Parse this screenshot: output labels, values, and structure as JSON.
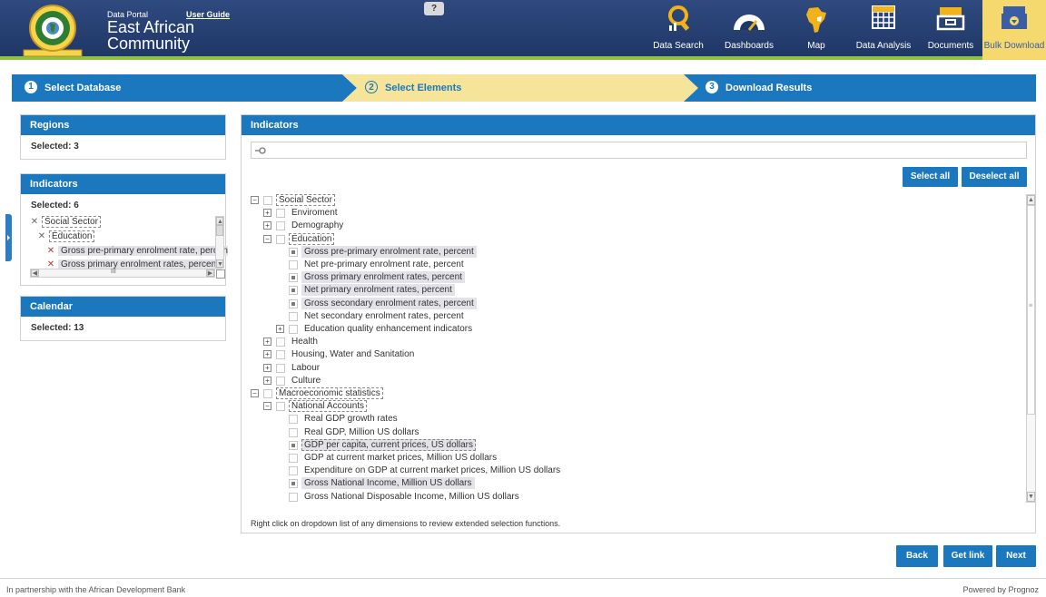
{
  "header": {
    "portal_label": "Data Portal",
    "user_guide": "User Guide",
    "title": "East African Community",
    "help": "?",
    "nav": [
      {
        "label": "Data Search",
        "icon": "search-chart-icon"
      },
      {
        "label": "Dashboards",
        "icon": "gauge-icon"
      },
      {
        "label": "Map",
        "icon": "africa-map-icon"
      },
      {
        "label": "Data Analysis",
        "icon": "grid-table-icon"
      },
      {
        "label": "Documents",
        "icon": "document-tray-icon"
      },
      {
        "label": "Bulk Download",
        "icon": "download-box-icon",
        "active": true
      }
    ]
  },
  "wizard": {
    "steps": [
      {
        "num": "1",
        "label": "Select Database"
      },
      {
        "num": "2",
        "label": "Select Elements"
      },
      {
        "num": "3",
        "label": "Download Results"
      }
    ]
  },
  "left": {
    "regions": {
      "title": "Regions",
      "selected": "Selected: 3"
    },
    "indicators": {
      "title": "Indicators",
      "selected": "Selected: 6",
      "tree": [
        "Social Sector",
        "Education",
        "Gross pre-primary enrolment rate, percen",
        "Gross primary enrolment rates, percent"
      ],
      "hscroll_thumb": "III"
    },
    "calendar": {
      "title": "Calendar",
      "selected": "Selected: 13"
    }
  },
  "main": {
    "title": "Indicators",
    "search": {
      "value": "",
      "placeholder": ""
    },
    "select_all": "Select all",
    "deselect_all": "Deselect all",
    "tree": [
      {
        "label": "Social Sector",
        "level": 0,
        "exp": "−",
        "checked": false,
        "style": "dash"
      },
      {
        "label": "Enviroment",
        "level": 1,
        "exp": "+",
        "checked": false
      },
      {
        "label": "Demography",
        "level": 1,
        "exp": "+",
        "checked": false
      },
      {
        "label": "Education",
        "level": 1,
        "exp": "−",
        "checked": false,
        "style": "dash"
      },
      {
        "label": "Gross pre-primary enrolment rate, percent",
        "level": 2,
        "checked": true,
        "style": "sel"
      },
      {
        "label": "Net pre-primary enrolment rate, percent",
        "level": 2,
        "checked": false
      },
      {
        "label": "Gross primary enrolment rates, percent",
        "level": 2,
        "checked": true,
        "style": "sel"
      },
      {
        "label": "Net primary enrolment rates, percent",
        "level": 2,
        "checked": true,
        "style": "sel"
      },
      {
        "label": "Gross secondary enrolment rates, percent",
        "level": 2,
        "checked": true,
        "style": "sel"
      },
      {
        "label": "Net secondary enrolment rates, percent",
        "level": 2,
        "checked": false
      },
      {
        "label": "Education quality enhancement indicators",
        "level": 2,
        "exp": "+",
        "checked": false
      },
      {
        "label": "Health",
        "level": 1,
        "exp": "+",
        "checked": false
      },
      {
        "label": "Housing, Water and Sanitation",
        "level": 1,
        "exp": "+",
        "checked": false
      },
      {
        "label": "Labour",
        "level": 1,
        "exp": "+",
        "checked": false
      },
      {
        "label": "Culture",
        "level": 1,
        "exp": "+",
        "checked": false
      },
      {
        "label": "Macroeconomic statistics",
        "level": 0,
        "exp": "−",
        "checked": false,
        "style": "dash"
      },
      {
        "label": "National Accounts",
        "level": 1,
        "exp": "−",
        "checked": false,
        "style": "dash"
      },
      {
        "label": "Real GDP growth rates",
        "level": 2,
        "checked": false
      },
      {
        "label": "Real GDP, Million US dollars",
        "level": 2,
        "checked": false
      },
      {
        "label": "GDP per capita, current prices, US dollars",
        "level": 2,
        "checked": true,
        "style": "seldash"
      },
      {
        "label": "GDP at current market prices, Million US dollars",
        "level": 2,
        "checked": false
      },
      {
        "label": "Expenditure on GDP at current market prices, Million US dollars",
        "level": 2,
        "checked": false
      },
      {
        "label": "Gross National Income, Million US dollars",
        "level": 2,
        "checked": true,
        "style": "sel"
      },
      {
        "label": "Gross National Disposable Income, Million US dollars",
        "level": 2,
        "checked": false
      }
    ],
    "hint": "Right click on dropdown list of any dimensions to review extended selection functions."
  },
  "actions": {
    "back": "Back",
    "get_link": "Get link",
    "next": "Next"
  },
  "footer": {
    "left": "In partnership with the African Development Bank",
    "right": "Powered by Prognoz"
  },
  "colors": {
    "header": "#1f3766",
    "accent": "#1b78bf",
    "active_step": "#f5e49a",
    "green_line": "#8dc43f"
  }
}
